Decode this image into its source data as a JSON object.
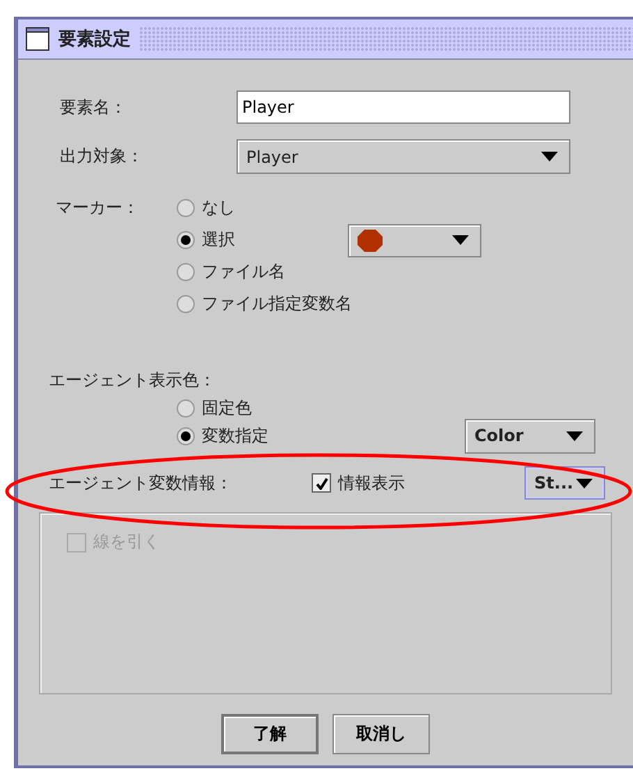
{
  "window": {
    "title": "要素設定"
  },
  "fields": [
    {
      "label": "要素名：",
      "kind": "text",
      "value": "Player"
    },
    {
      "label": "出力対象：",
      "kind": "dropdown",
      "value": "Player"
    }
  ],
  "marker": {
    "label": "マーカー：",
    "options": [
      {
        "label": "なし",
        "selected": false
      },
      {
        "label": "選択",
        "selected": true
      },
      {
        "label": "ファイル名",
        "selected": false
      },
      {
        "label": "ファイル指定変数名",
        "selected": false
      }
    ]
  },
  "agent_color": {
    "label": "エージェント表示色：",
    "options": [
      {
        "label": "固定色",
        "selected": false
      },
      {
        "label": "変数指定",
        "selected": true
      }
    ],
    "dropdown": "Color"
  },
  "agent_info": {
    "label": "エージェント変数情報：",
    "checkbox": {
      "label": "情報表示",
      "checked": true
    },
    "dropdown": "St..."
  },
  "line_option": {
    "label": "線を引く",
    "checked": false,
    "disabled": true
  },
  "buttons": [
    {
      "label": "了解",
      "default": true
    },
    {
      "label": "取消し",
      "default": false
    }
  ]
}
